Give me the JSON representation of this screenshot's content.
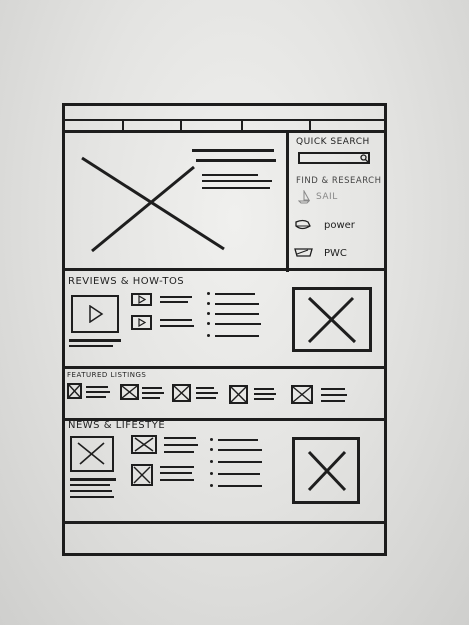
{
  "nav": {
    "tabs": [
      "",
      "",
      "",
      "",
      ""
    ]
  },
  "sidebar": {
    "quick_search_title": "QUICK SEARCH",
    "find_research_title": "FIND & RESEARCH",
    "items": [
      {
        "label": "SAIL",
        "icon": "sailboat-icon"
      },
      {
        "label": "power",
        "icon": "powerboat-icon"
      },
      {
        "label": "PWC",
        "icon": "jetski-icon"
      }
    ]
  },
  "reviews": {
    "title": "REVIEWS & HOW-TOs"
  },
  "featured": {
    "title": "FEATURED LISTINGS"
  },
  "news": {
    "title": "NEWS & LIFESTYE"
  }
}
